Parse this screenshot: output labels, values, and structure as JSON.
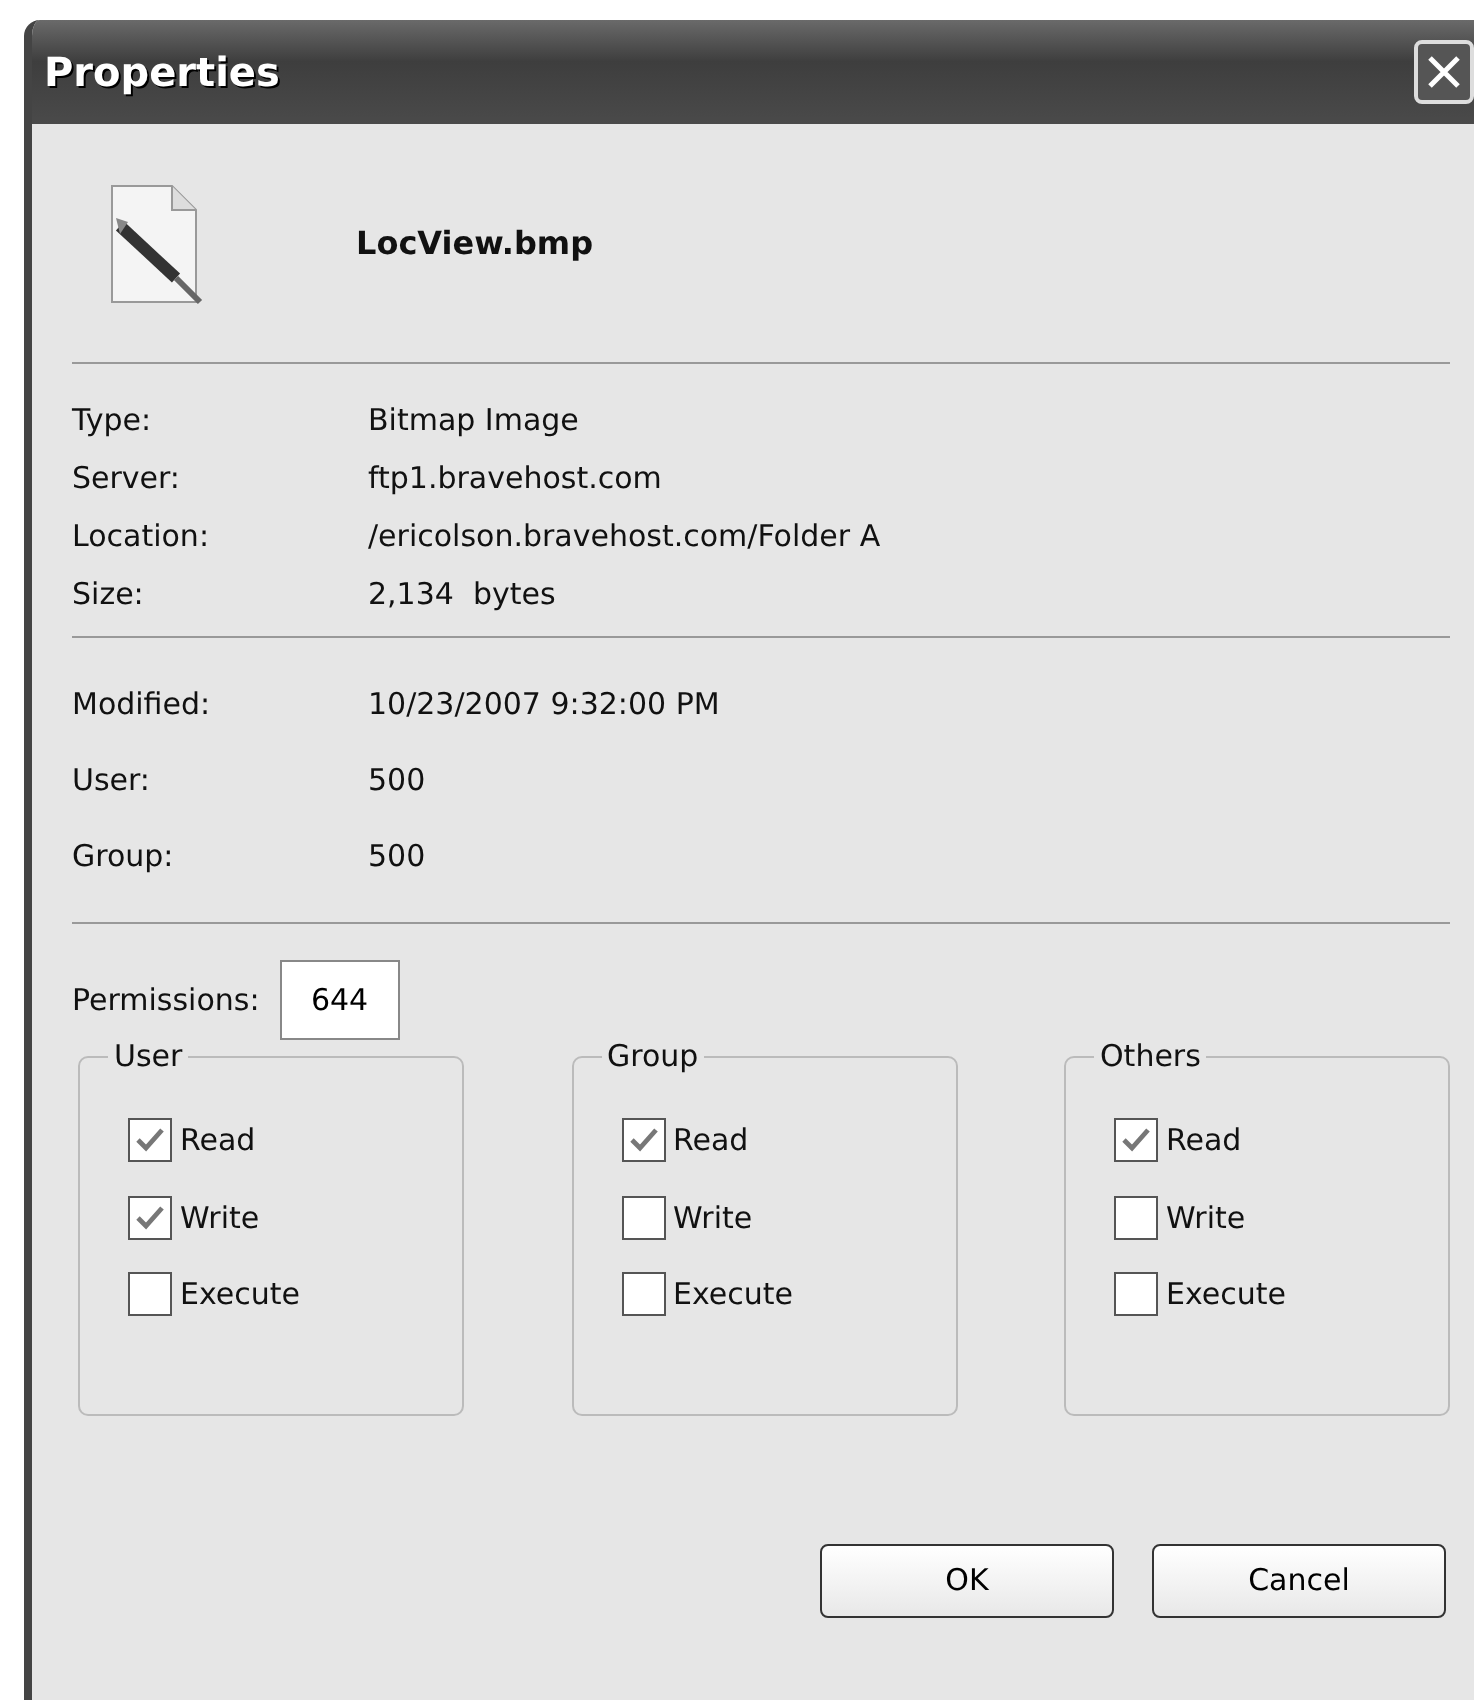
{
  "window": {
    "title": "Properties"
  },
  "file": {
    "name": "LocView.bmp"
  },
  "details": [
    {
      "label": "Type:",
      "value": "Bitmap Image"
    },
    {
      "label": "Server:",
      "value": "ftp1.bravehost.com"
    },
    {
      "label": "Location:",
      "value": "/ericolson.bravehost.com/Folder A"
    },
    {
      "label": "Size:",
      "value": "2,134  bytes"
    }
  ],
  "attributes": [
    {
      "label": "Modified:",
      "value": "10/23/2007 9:32:00 PM"
    },
    {
      "label": "User:",
      "value": "500"
    },
    {
      "label": "Group:",
      "value": "500"
    }
  ],
  "permissions": {
    "label": "Permissions:",
    "value": "644"
  },
  "groups": [
    {
      "title": "User",
      "options": [
        {
          "label": "Read",
          "checked": true
        },
        {
          "label": "Write",
          "checked": true
        },
        {
          "label": "Execute",
          "checked": false
        }
      ]
    },
    {
      "title": "Group",
      "options": [
        {
          "label": "Read",
          "checked": true
        },
        {
          "label": "Write",
          "checked": false
        },
        {
          "label": "Execute",
          "checked": false
        }
      ]
    },
    {
      "title": "Others",
      "options": [
        {
          "label": "Read",
          "checked": true
        },
        {
          "label": "Write",
          "checked": false
        },
        {
          "label": "Execute",
          "checked": false
        }
      ]
    }
  ],
  "buttons": [
    "OK",
    "Cancel"
  ]
}
